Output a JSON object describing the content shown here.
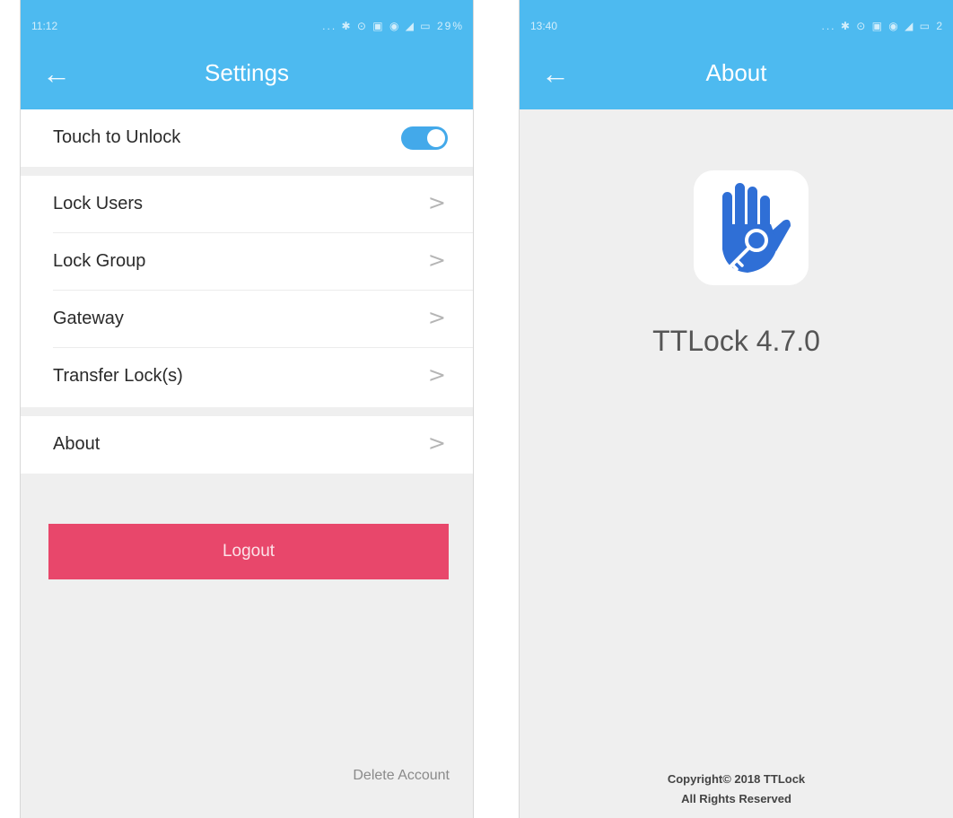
{
  "settings_screen": {
    "status_time": "11:12",
    "status_icons": "... ✱ ⊙ ▣ ◉ ◢ ▭ 29%",
    "title": "Settings",
    "touch_to_unlock": {
      "label": "Touch to Unlock",
      "enabled": true
    },
    "menu_items": [
      {
        "label": "Lock Users",
        "chevron": ">"
      },
      {
        "label": "Lock Group",
        "chevron": ">"
      },
      {
        "label": "Gateway",
        "chevron": ">"
      },
      {
        "label": "Transfer Lock(s)",
        "chevron": ">"
      }
    ],
    "about_item": {
      "label": "About",
      "chevron": ">"
    },
    "logout_label": "Logout",
    "delete_account_label": "Delete Account"
  },
  "about_screen": {
    "status_time": "13:40",
    "status_icons": "... ✱ ⊙ ▣ ◉ ◢ ▭ 2",
    "title": "About",
    "app_version": "TTLock 4.7.0",
    "copyright_line1": "Copyright© 2018 TTLock",
    "copyright_line2": "All Rights Reserved"
  },
  "colors": {
    "app_bar": "#4dbaf0",
    "toggle_on": "#43a9ea",
    "logout_button": "#e8476b",
    "logo_blue": "#2f6fd6",
    "background": "#efefef"
  },
  "icons": {
    "back": "back-arrow-icon",
    "chevron": "chevron-right-icon",
    "logo": "hand-key-logo"
  }
}
